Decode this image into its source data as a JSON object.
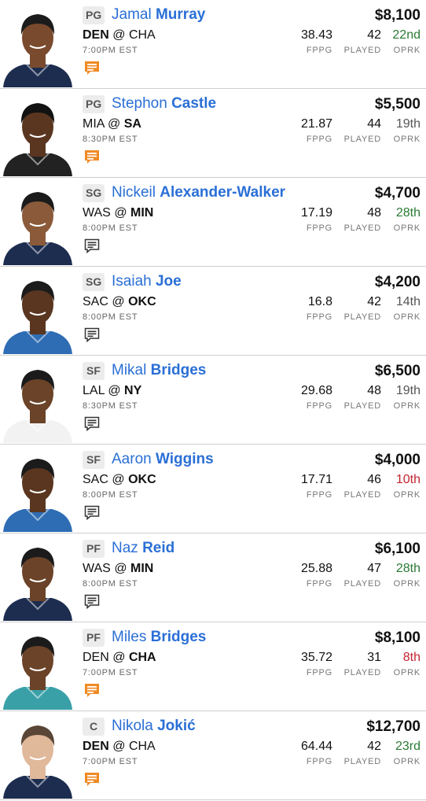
{
  "colors": {
    "link_blue": "#2a6fd6",
    "note_orange": "#f08a24",
    "note_outline": "#333333",
    "oprk_good": "#2b7a34",
    "oprk_bad": "#c4232f",
    "oprk_neutral": "#555555"
  },
  "labels": {
    "fppg": "FPPG",
    "played": "PLAYED",
    "oprk": "OPRK",
    "at": "@"
  },
  "players": [
    {
      "pos": "PG",
      "first": "Jamal",
      "last": "Murray",
      "salary": "$8,100",
      "team": "DEN",
      "opp": "CHA",
      "bold": "team",
      "time": "7:00PM EST",
      "fppg": "38.43",
      "played": "42",
      "oprk": "22nd",
      "oprk_tone": "good",
      "note_icon": "news-alert-icon",
      "jersey": "#1d2d50",
      "skin": "#7a4a2e",
      "hair": "#1b1b1b"
    },
    {
      "pos": "PG",
      "first": "Stephon",
      "last": "Castle",
      "salary": "$5,500",
      "team": "MIA",
      "opp": "SA",
      "bold": "opp",
      "time": "8:30PM EST",
      "fppg": "21.87",
      "played": "44",
      "oprk": "19th",
      "oprk_tone": "neutral",
      "note_icon": "news-alert-icon",
      "jersey": "#222222",
      "skin": "#5a3620",
      "hair": "#121212"
    },
    {
      "pos": "SG",
      "first": "Nickeil",
      "last": "Alexander-Walker",
      "salary": "$4,700",
      "team": "WAS",
      "opp": "MIN",
      "bold": "opp",
      "time": "8:00PM EST",
      "fppg": "17.19",
      "played": "48",
      "oprk": "28th",
      "oprk_tone": "good",
      "note_icon": "news-icon",
      "jersey": "#1d2d50",
      "skin": "#8a5a3a",
      "hair": "#1b1b1b"
    },
    {
      "pos": "SG",
      "first": "Isaiah",
      "last": "Joe",
      "salary": "$4,200",
      "team": "SAC",
      "opp": "OKC",
      "bold": "opp",
      "time": "8:00PM EST",
      "fppg": "16.8",
      "played": "42",
      "oprk": "14th",
      "oprk_tone": "neutral",
      "note_icon": "news-icon",
      "jersey": "#2e6db4",
      "skin": "#5a3620",
      "hair": "#1b1b1b"
    },
    {
      "pos": "SF",
      "first": "Mikal",
      "last": "Bridges",
      "salary": "$6,500",
      "team": "LAL",
      "opp": "NY",
      "bold": "opp",
      "time": "8:30PM EST",
      "fppg": "29.68",
      "played": "48",
      "oprk": "19th",
      "oprk_tone": "neutral",
      "note_icon": "news-icon",
      "jersey": "#f2f2f2",
      "skin": "#6b4328",
      "hair": "#1b1b1b"
    },
    {
      "pos": "SF",
      "first": "Aaron",
      "last": "Wiggins",
      "salary": "$4,000",
      "team": "SAC",
      "opp": "OKC",
      "bold": "opp",
      "time": "8:00PM EST",
      "fppg": "17.71",
      "played": "46",
      "oprk": "10th",
      "oprk_tone": "bad",
      "note_icon": "news-icon",
      "jersey": "#2e6db4",
      "skin": "#5a3620",
      "hair": "#1b1b1b"
    },
    {
      "pos": "PF",
      "first": "Naz",
      "last": "Reid",
      "salary": "$6,100",
      "team": "WAS",
      "opp": "MIN",
      "bold": "opp",
      "time": "8:00PM EST",
      "fppg": "25.88",
      "played": "47",
      "oprk": "28th",
      "oprk_tone": "good",
      "note_icon": "news-icon",
      "jersey": "#1d2d50",
      "skin": "#6b4328",
      "hair": "#1b1b1b"
    },
    {
      "pos": "PF",
      "first": "Miles",
      "last": "Bridges",
      "salary": "$8,100",
      "team": "DEN",
      "opp": "CHA",
      "bold": "opp",
      "time": "7:00PM EST",
      "fppg": "35.72",
      "played": "31",
      "oprk": "8th",
      "oprk_tone": "bad",
      "note_icon": "news-alert-icon",
      "jersey": "#3aa0a8",
      "skin": "#6b4328",
      "hair": "#1b1b1b"
    },
    {
      "pos": "C",
      "first": "Nikola",
      "last": "Jokić",
      "salary": "$12,700",
      "team": "DEN",
      "opp": "CHA",
      "bold": "team",
      "time": "7:00PM EST",
      "fppg": "64.44",
      "played": "42",
      "oprk": "23rd",
      "oprk_tone": "good",
      "note_icon": "news-alert-icon",
      "jersey": "#1d2d50",
      "skin": "#e0b89a",
      "hair": "#5a4636"
    }
  ]
}
